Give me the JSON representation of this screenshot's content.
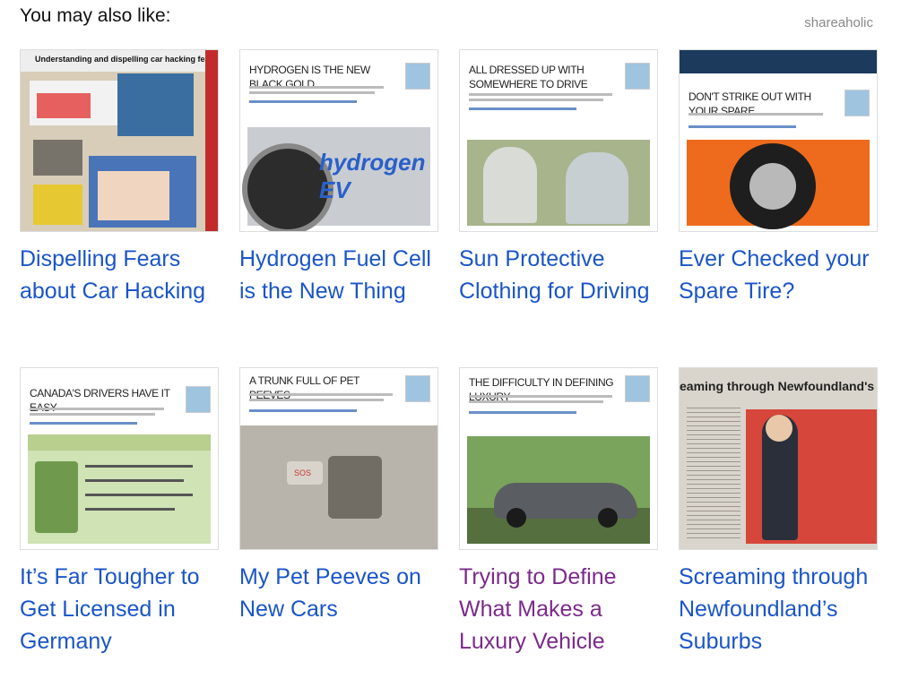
{
  "header": {
    "heading": "You may also like:",
    "brand": "shareaholic"
  },
  "cards": [
    {
      "title": "Dispelling Fears about Car Hacking",
      "visited": false,
      "thumb_text": "Understanding and dispelling car hacking fears"
    },
    {
      "title": "Hydrogen Fuel Cell is the New Thing",
      "visited": false,
      "thumb_text": "HYDROGEN IS THE NEW BLACK GOLD"
    },
    {
      "title": "Sun Protective Clothing for Driving",
      "visited": false,
      "thumb_text": "ALL DRESSED UP WITH SOMEWHERE TO DRIVE"
    },
    {
      "title": "Ever Checked your Spare Tire?",
      "visited": false,
      "thumb_text": "DON'T STRIKE OUT WITH YOUR SPARE"
    },
    {
      "title": "It’s Far Tougher to Get Licensed in Germany",
      "visited": false,
      "thumb_text": "CANADA'S DRIVERS HAVE IT EASY"
    },
    {
      "title": "My Pet Peeves on New Cars",
      "visited": false,
      "thumb_text": "A TRUNK FULL OF PET PEEVES"
    },
    {
      "title": "Trying to Define What Makes a Luxury Vehicle",
      "visited": true,
      "thumb_text": "THE DIFFICULTY IN DEFINING LUXURY"
    },
    {
      "title": "Screaming through Newfoundland’s Suburbs",
      "visited": false,
      "thumb_text": "eaming through Newfoundland's subur"
    }
  ]
}
